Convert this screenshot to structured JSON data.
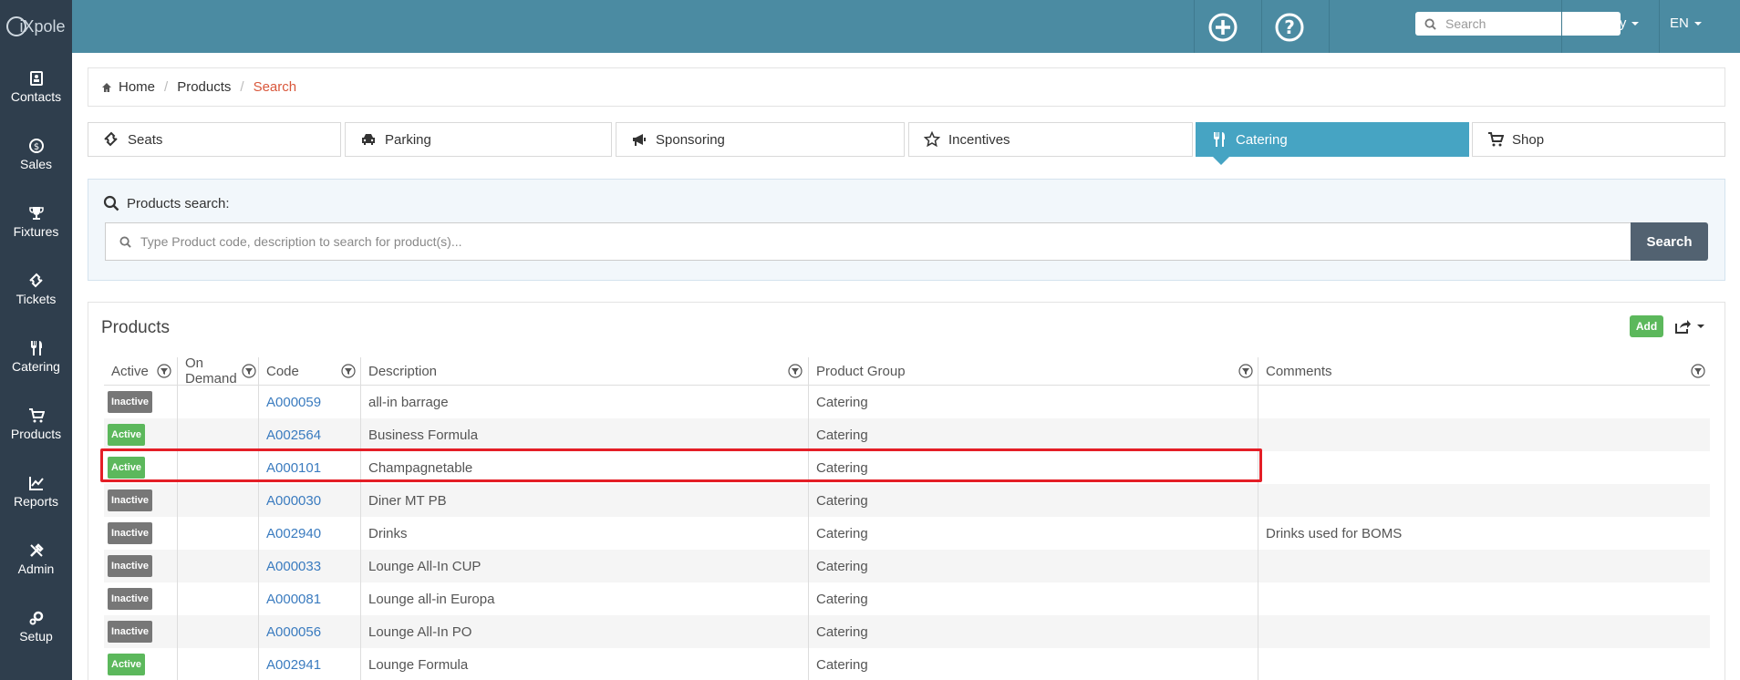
{
  "logo_text": "iXpole",
  "sidebar": {
    "items": [
      {
        "label": "Contacts",
        "icon": "contacts-icon"
      },
      {
        "label": "Sales",
        "icon": "dollar-icon"
      },
      {
        "label": "Fixtures",
        "icon": "trophy-icon"
      },
      {
        "label": "Tickets",
        "icon": "ticket-icon"
      },
      {
        "label": "Catering",
        "icon": "cutlery-icon"
      },
      {
        "label": "Products",
        "icon": "cart-icon"
      },
      {
        "label": "Reports",
        "icon": "chart-icon"
      },
      {
        "label": "Admin",
        "icon": "tools-icon"
      },
      {
        "label": "Setup",
        "icon": "gears-icon"
      }
    ]
  },
  "topbar": {
    "search_placeholder": "Search",
    "user": "Robby",
    "language": "EN"
  },
  "breadcrumb": {
    "home": "Home",
    "products": "Products",
    "current": "Search"
  },
  "tabs": [
    {
      "label": "Seats",
      "icon": "ticket-icon"
    },
    {
      "label": "Parking",
      "icon": "car-icon"
    },
    {
      "label": "Sponsoring",
      "icon": "megaphone-icon"
    },
    {
      "label": "Incentives",
      "icon": "star-icon"
    },
    {
      "label": "Catering",
      "icon": "cutlery-icon",
      "selected": true
    },
    {
      "label": "Shop",
      "icon": "cart-icon"
    }
  ],
  "search_panel": {
    "title": "Products search:",
    "placeholder": "Type Product code, description to search for product(s)...",
    "button": "Search"
  },
  "products": {
    "title": "Products",
    "add_label": "Add",
    "columns": [
      "Active",
      "On Demand",
      "Code",
      "Description",
      "Product Group",
      "Comments"
    ],
    "rows": [
      {
        "status": "Inactive",
        "on_demand": "",
        "code": "A000059",
        "description": "all-in barrage",
        "group": "Catering",
        "comments": ""
      },
      {
        "status": "Active",
        "on_demand": "",
        "code": "A002564",
        "description": "Business Formula",
        "group": "Catering",
        "comments": ""
      },
      {
        "status": "Active",
        "on_demand": "",
        "code": "A000101",
        "description": "Champagnetable",
        "group": "Catering",
        "comments": ""
      },
      {
        "status": "Inactive",
        "on_demand": "",
        "code": "A000030",
        "description": "Diner MT PB",
        "group": "Catering",
        "comments": ""
      },
      {
        "status": "Inactive",
        "on_demand": "",
        "code": "A002940",
        "description": "Drinks",
        "group": "Catering",
        "comments": "Drinks used for BOMS"
      },
      {
        "status": "Inactive",
        "on_demand": "",
        "code": "A000033",
        "description": "Lounge All-In CUP",
        "group": "Catering",
        "comments": ""
      },
      {
        "status": "Inactive",
        "on_demand": "",
        "code": "A000081",
        "description": "Lounge all-in Europa",
        "group": "Catering",
        "comments": ""
      },
      {
        "status": "Inactive",
        "on_demand": "",
        "code": "A000056",
        "description": "Lounge All-In PO",
        "group": "Catering",
        "comments": ""
      },
      {
        "status": "Active",
        "on_demand": "",
        "code": "A002941",
        "description": "Lounge Formula",
        "group": "Catering",
        "comments": ""
      }
    ]
  },
  "colors": {
    "topbar": "#4b8ba2",
    "sidebar": "#2f3e4d",
    "tab_selected": "#46a4c3",
    "badge_active": "#5cb85c",
    "badge_inactive": "#777777",
    "link": "#3a7bbf",
    "highlight": "#e41e26"
  }
}
